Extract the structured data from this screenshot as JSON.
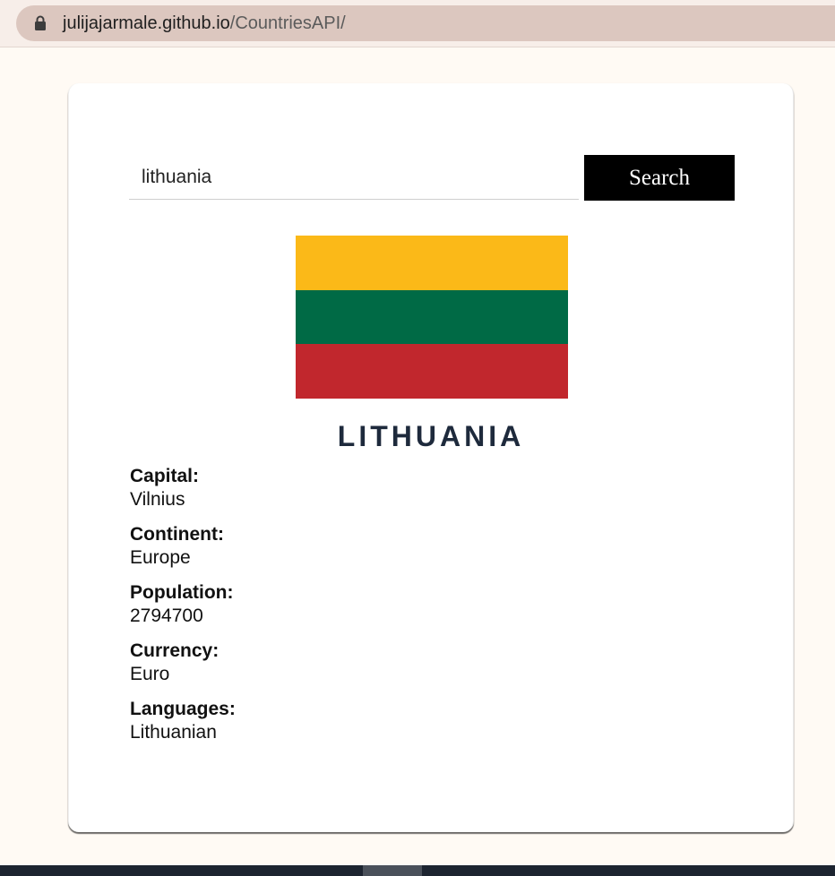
{
  "browser": {
    "url_host": "julijajarmale.github.io",
    "url_path": "/CountriesAPI/",
    "lock_icon": "lock-icon"
  },
  "search": {
    "value": "lithuania",
    "button_label": "Search"
  },
  "country": {
    "name": "LITHUANIA",
    "flag_colors": [
      "#fbb918",
      "#006a45",
      "#c1272d"
    ]
  },
  "details": [
    {
      "label": "Capital:",
      "value": "Vilnius"
    },
    {
      "label": "Continent:",
      "value": "Europe"
    },
    {
      "label": "Population:",
      "value": "2794700"
    },
    {
      "label": "Currency:",
      "value": "Euro"
    },
    {
      "label": "Languages:",
      "value": "Lithuanian"
    }
  ]
}
